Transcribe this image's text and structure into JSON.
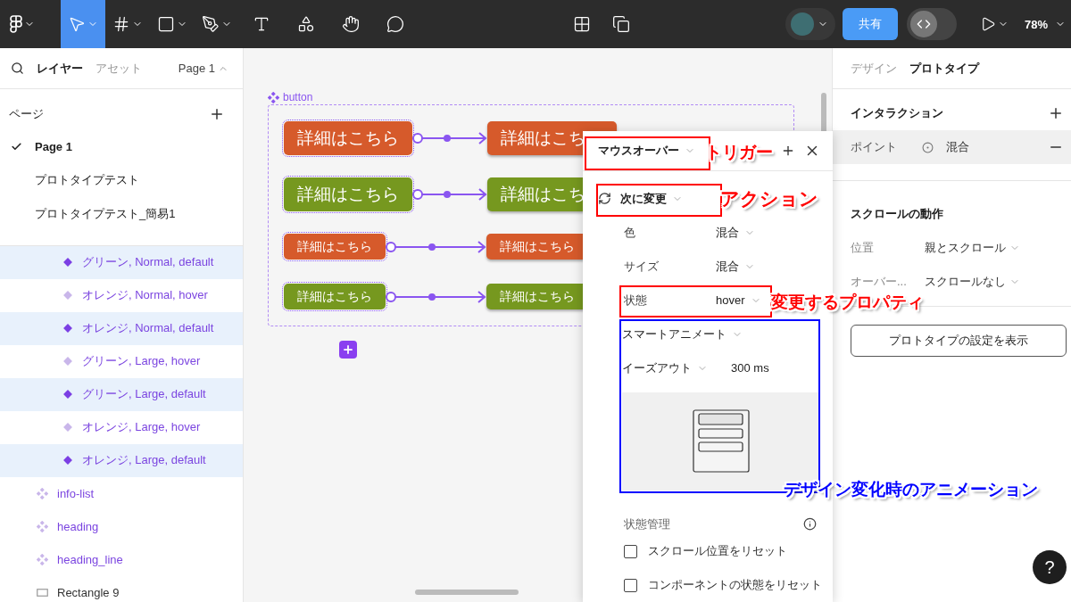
{
  "toolbar": {
    "tools": [
      {
        "kind": "logo",
        "selected": false
      },
      {
        "kind": "move",
        "selected": true
      },
      {
        "kind": "frame",
        "selected": false
      },
      {
        "kind": "shape",
        "selected": false
      },
      {
        "kind": "pen",
        "selected": false
      },
      {
        "kind": "text",
        "selected": false
      },
      {
        "kind": "actions",
        "selected": false
      },
      {
        "kind": "hand",
        "selected": false
      },
      {
        "kind": "comment",
        "selected": false
      }
    ],
    "share_button": "共有",
    "dev_mode_on": false,
    "zoom": "78%"
  },
  "left_panel": {
    "tabs": [
      {
        "label": "レイヤー",
        "selected": true
      },
      {
        "label": "アセット",
        "selected": false
      }
    ],
    "page_selector": "Page 1",
    "pages_header": "ページ",
    "pages": [
      {
        "label": "Page 1",
        "selected": true
      },
      {
        "label": "プロトタイプテスト",
        "selected": false
      },
      {
        "label": "プロトタイプテスト_簡易1",
        "selected": false
      }
    ],
    "layers": [
      {
        "kind": "variant",
        "label": "グリーン, Normal, default",
        "selected": true
      },
      {
        "kind": "variant",
        "label": "オレンジ, Normal, hover",
        "selected": false
      },
      {
        "kind": "variant",
        "label": "オレンジ, Normal, default",
        "selected": true
      },
      {
        "kind": "variant",
        "label": "グリーン, Large, hover",
        "selected": false
      },
      {
        "kind": "variant",
        "label": "グリーン, Large, default",
        "selected": true
      },
      {
        "kind": "variant",
        "label": "オレンジ, Large, hover",
        "selected": false
      },
      {
        "kind": "variant",
        "label": "オレンジ, Large, default",
        "selected": true
      },
      {
        "kind": "component",
        "label": "info-list",
        "selected": false
      },
      {
        "kind": "component",
        "label": "heading",
        "selected": false
      },
      {
        "kind": "component",
        "label": "heading_line",
        "selected": false
      },
      {
        "kind": "rectangle",
        "label": "Rectangle 9",
        "selected": false
      }
    ]
  },
  "canvas": {
    "frame_label": "button",
    "rows": [
      {
        "kind": "large",
        "source": {
          "text": "詳細はこちら",
          "color": "#d65a2b"
        },
        "target": {
          "text": "詳細はこち",
          "color": "#d65a2b"
        }
      },
      {
        "kind": "large",
        "source": {
          "text": "詳細はこちら",
          "color": "#76981f"
        },
        "target": {
          "text": "詳細はこち",
          "color": "#76981f"
        }
      },
      {
        "kind": "normal",
        "source": {
          "text": "詳細はこちら",
          "color": "#d65a2b"
        },
        "target": {
          "text": "詳細はこちら",
          "color": "#d65a2b"
        }
      },
      {
        "kind": "normal",
        "source": {
          "text": "詳細はこちら",
          "color": "#76981f"
        },
        "target": {
          "text": "詳細はこちら",
          "color": "#76981f"
        }
      }
    ]
  },
  "interaction_popup": {
    "trigger": "マウスオーバー",
    "action": "次に変更",
    "properties": [
      {
        "label": "色",
        "value": "混合"
      },
      {
        "label": "サイズ",
        "value": "混合"
      },
      {
        "label": "状態",
        "value": "hover"
      }
    ],
    "animation": "スマートアニメート",
    "easing": "イーズアウト",
    "duration": "300 ms",
    "state_management": "状態管理",
    "checkboxes": [
      {
        "label": "スクロール位置をリセット",
        "checked": false
      },
      {
        "label": "コンポーネントの状態をリセット",
        "checked": false
      }
    ]
  },
  "right_panel": {
    "tabs": [
      {
        "label": "デザイン",
        "selected": false
      },
      {
        "label": "プロトタイプ",
        "selected": true
      }
    ],
    "interactions_header": "インタラクション",
    "interaction": {
      "trigger": "ポイント",
      "value": "混合"
    },
    "scroll_header": "スクロールの動作",
    "scroll_rows": [
      {
        "label": "位置",
        "value": "親とスクロール"
      },
      {
        "label": "オーバー...",
        "value": "スクロールなし"
      }
    ],
    "settings_button": "プロトタイプの設定を表示",
    "help_button": "?"
  },
  "annotations": [
    {
      "label": "トリガー",
      "color": "#ff0000"
    },
    {
      "label": "アクション",
      "color": "#ff0000"
    },
    {
      "label": "変更するプロパティ",
      "color": "#ff0000"
    },
    {
      "label": "デザイン変化時のアニメーション",
      "color": "#0000ff"
    }
  ]
}
